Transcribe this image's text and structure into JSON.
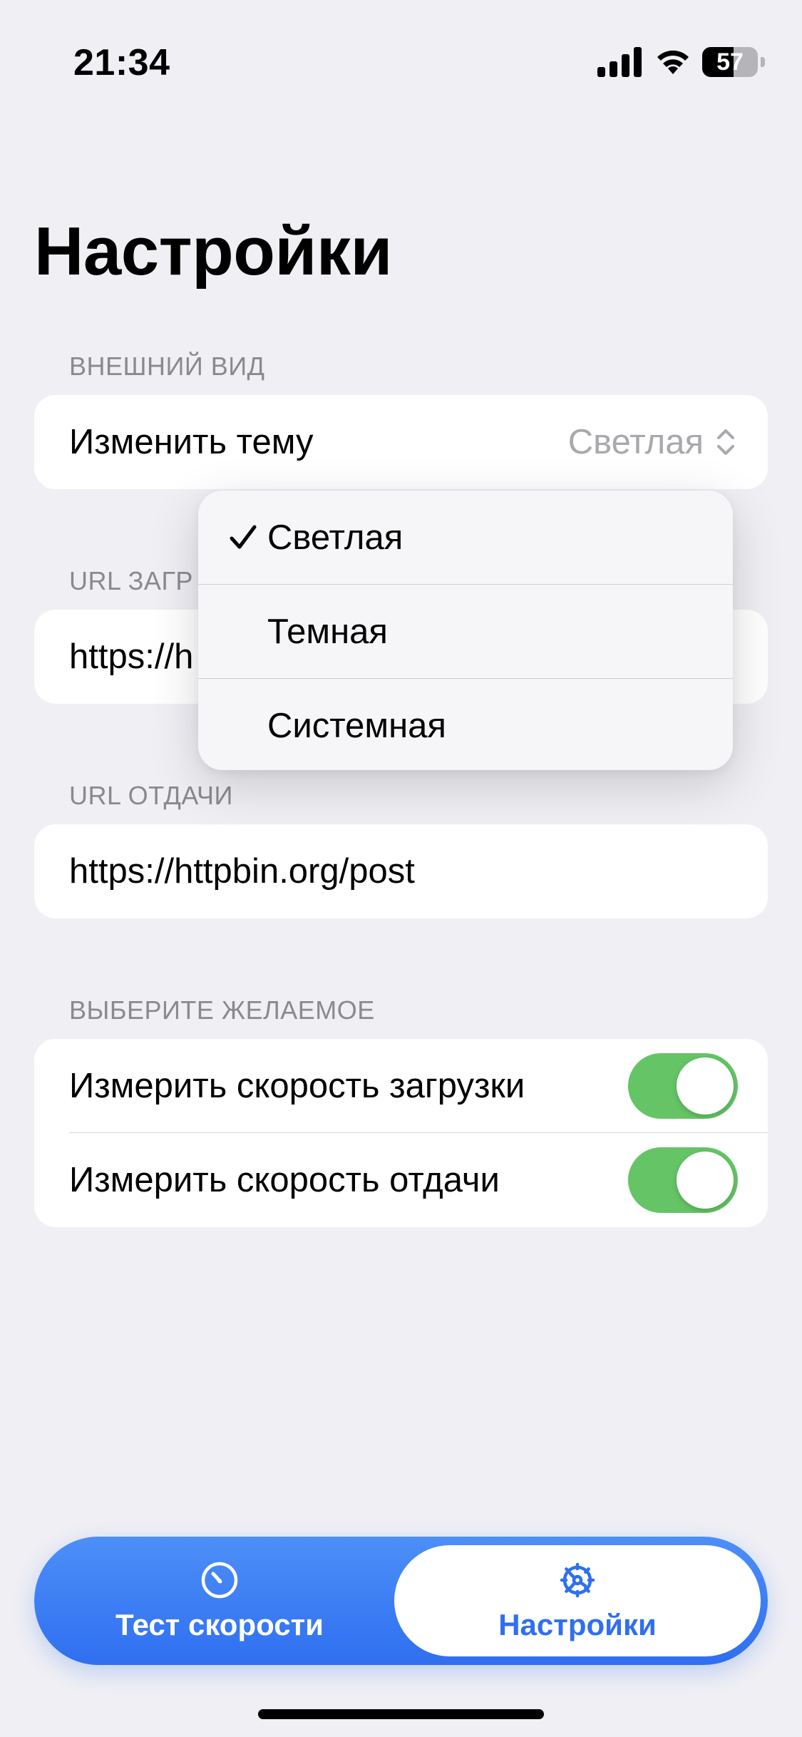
{
  "status_bar": {
    "time": "21:34",
    "battery_percent": 57,
    "battery_label": "57"
  },
  "page": {
    "title": "Настройки"
  },
  "appearance": {
    "header": "ВНЕШНИЙ ВИД",
    "theme_label": "Изменить тему",
    "theme_value": "Светлая"
  },
  "theme_menu": {
    "options": [
      {
        "label": "Светлая",
        "selected": true
      },
      {
        "label": "Темная",
        "selected": false
      },
      {
        "label": "Системная",
        "selected": false
      }
    ]
  },
  "download_url": {
    "header": "URL ЗАГР",
    "value": "https://h"
  },
  "upload_url": {
    "header": "URL ОТДАЧИ",
    "value": "https://httpbin.org/post"
  },
  "options": {
    "header": "ВЫБЕРИТЕ ЖЕЛАЕМОЕ",
    "items": [
      {
        "label": "Измерить скорость загрузки",
        "enabled": true
      },
      {
        "label": "Измерить скорость отдачи",
        "enabled": true
      }
    ]
  },
  "tab_bar": {
    "tabs": [
      {
        "label": "Тест скорости",
        "icon": "speedometer-icon",
        "active": false
      },
      {
        "label": "Настройки",
        "icon": "gear-icon",
        "active": true
      }
    ]
  },
  "colors": {
    "accent": "#2f6ff0",
    "toggle_on": "#65c466",
    "background": "#efeff4"
  }
}
